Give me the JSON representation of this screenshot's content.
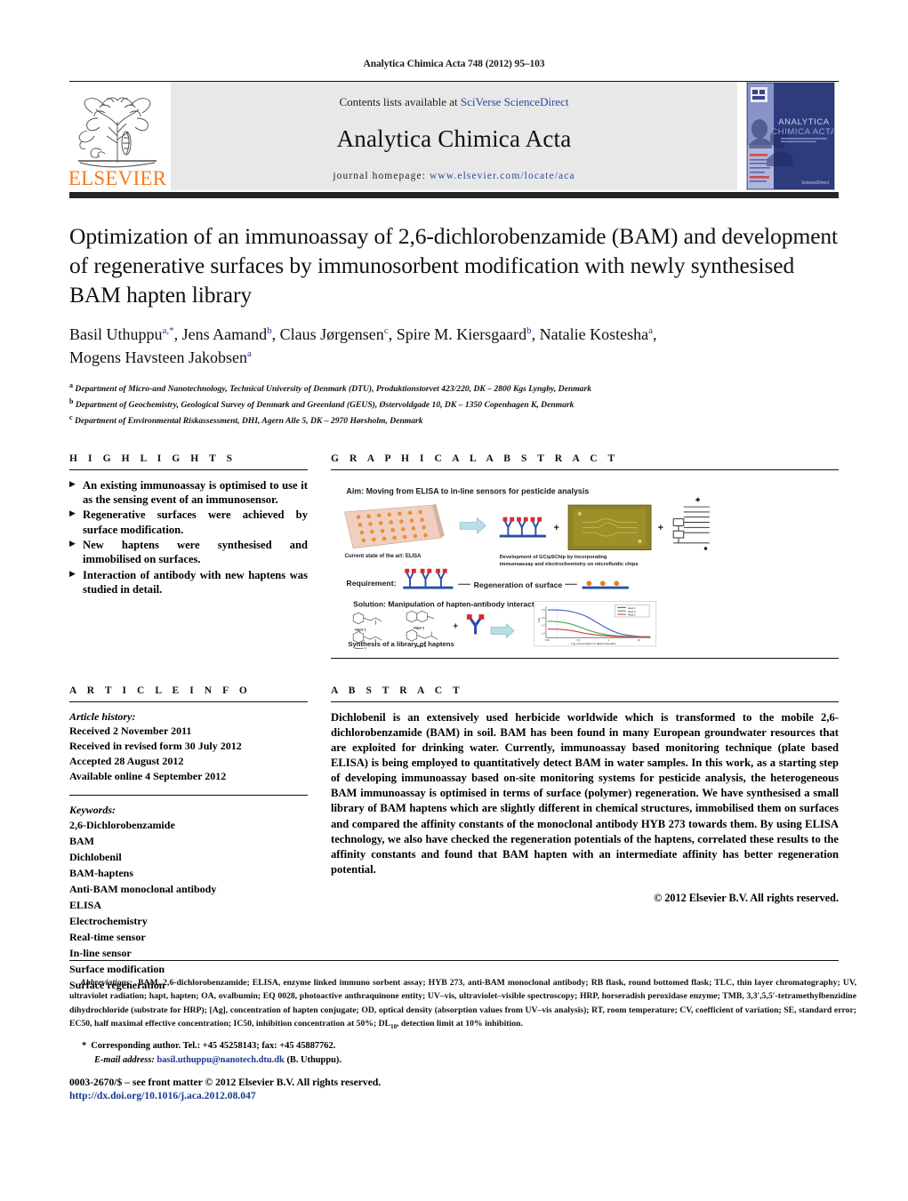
{
  "running_head": "Analytica Chimica Acta 748 (2012) 95–103",
  "masthead": {
    "publisher_logo_text": "ELSEVIER",
    "contents_prefix": "Contents lists available at ",
    "contents_link": "SciVerse ScienceDirect",
    "journal_title": "Analytica Chimica Acta",
    "homepage_label": "journal homepage: ",
    "homepage_url": "www.elsevier.com/locate/aca",
    "cover_title_line1": "ANALYTICA",
    "cover_title_line2": "CHIMICA ACTA"
  },
  "article": {
    "title": "Optimization of an immunoassay of 2,6-dichlorobenzamide (BAM) and development of regenerative surfaces by immunosorbent modification with newly synthesised BAM hapten library",
    "authors_line1": "Basil Uthuppu a,*, Jens Aamand b, Claus Jørgensen c, Spire M. Kiersgaard b, Natalie Kostesha a,",
    "authors_line2": "Mogens Havsteen Jakobsen a",
    "authors": [
      {
        "name": "Basil Uthuppu",
        "sup": "a,*"
      },
      {
        "name": "Jens Aamand",
        "sup": "b"
      },
      {
        "name": "Claus Jørgensen",
        "sup": "c"
      },
      {
        "name": "Spire M. Kiersgaard",
        "sup": "b"
      },
      {
        "name": "Natalie Kostesha",
        "sup": "a"
      },
      {
        "name": "Mogens Havsteen Jakobsen",
        "sup": "a"
      }
    ],
    "affiliations": [
      {
        "marker": "a",
        "text": "Department of Micro-and Nanotechnology, Technical University of Denmark (DTU), Produktionstorvet 423/220, DK – 2800 Kgs Lyngby, Denmark"
      },
      {
        "marker": "b",
        "text": "Department of Geochemistry, Geological Survey of Denmark and Greenland (GEUS), Østervoldgade 10, DK – 1350 Copenhagen K, Denmark"
      },
      {
        "marker": "c",
        "text": "Department of Environmental Riskassessment, DHI, Agern Alle 5, DK – 2970 Hørsholm, Denmark"
      }
    ]
  },
  "highlights": {
    "heading": "H I G H L I G H T S",
    "items": [
      "An existing immunoassay is optimised to use it as the sensing event of an immunosensor.",
      "Regenerative surfaces were achieved by surface modification.",
      "New haptens were synthesised and immobilised on surfaces.",
      "Interaction of antibody with new haptens was studied in detail."
    ]
  },
  "graphical_abstract": {
    "heading": "G R A P H I C A L   A B S T R A C T",
    "aim_line": "Aim: Moving from ELISA to in-line sensors for pesticide analysis",
    "caption_plate": "Current state of the art: ELISA",
    "caption_chip_line1": "Development of GC/µSChip by incorporating",
    "caption_chip_line2": "immunoassay and electrochemistry on microfluidic chips",
    "requirement_label": "Requirement:",
    "regeneration_label": "Regeneration of surface",
    "solution_line": "Solution: Manipulation of hapten-antibody interaction",
    "synthesis_caption": "Synthesis of a library of haptens",
    "structure_labels": [
      "Hapt 1",
      "Hapt 2",
      "Hapt 3",
      "Hapt 4"
    ],
    "chart_legend": [
      "Hapt 1",
      "Hapt 2",
      "Hapt 3"
    ],
    "chart_xlabel": "Log concentration of added standard",
    "chart_ylabel": "OD"
  },
  "article_info": {
    "heading": "A R T I C L E   I N F O",
    "history_label": "Article history:",
    "history": [
      "Received 2 November 2011",
      "Received in revised form 30 July 2012",
      "Accepted 28 August 2012",
      "Available online 4 September 2012"
    ],
    "keywords_label": "Keywords:",
    "keywords": [
      "2,6-Dichlorobenzamide",
      "BAM",
      "Dichlobenil",
      "BAM-haptens",
      "Anti-BAM monoclonal antibody",
      "ELISA",
      "Electrochemistry",
      "Real-time sensor",
      "In-line sensor",
      "Surface modification",
      "Surface regeneration"
    ]
  },
  "abstract": {
    "heading": "A B S T R A C T",
    "body": "Dichlobenil is an extensively used herbicide worldwide which is transformed to the mobile 2,6-dichlorobenzamide (BAM) in soil. BAM has been found in many European groundwater resources that are exploited for drinking water. Currently, immunoassay based monitoring technique (plate based ELISA) is being employed to quantitatively detect BAM in water samples. In this work, as a starting step of developing immunoassay based on-site monitoring systems for pesticide analysis, the heterogeneous BAM immunoassay is optimised in terms of surface (polymer) regeneration. We have synthesised a small library of BAM haptens which are slightly different in chemical structures, immobilised them on surfaces and compared the affinity constants of the monoclonal antibody HYB 273 towards them. By using ELISA technology, we also have checked the regeneration potentials of the haptens, correlated these results to the affinity constants and found that BAM hapten with an intermediate affinity has better regeneration potential.",
    "copyright": "© 2012 Elsevier B.V. All rights reserved."
  },
  "footer": {
    "abbrev_label": "Abbreviations:",
    "abbrev_text": "BAM, 2,6-dichlorobenzamide; ELISA, enzyme linked immuno sorbent assay; HYB 273, anti-BAM monoclonal antibody; RB flask, round bottomed flask; TLC, thin layer chromatography; UV, ultraviolet radiation; hapt, hapten; OA, ovalbumin; EQ 0028, photoactive anthraquinone entity; UV–vis, ultraviolet–visible spectroscopy; HRP, horseradish peroxidase enzyme; TMB, 3,3′,5,5′-tetramethylbenzidine dihydrochloride (substrate for HRP); [Ag], concentration of hapten conjugate; OD, optical density (absorption values from UV–vis analysis); RT, room temperature; CV, coefficient of variation; SE, standard error; EC50, half maximal effective concentration; IC50, inhibition concentration at 50%; DL",
    "abbrev_sub": "10",
    "abbrev_tail": ", detection limit at 10% inhibition.",
    "corresponding": "Corresponding author. Tel.: +45 45258143; fax: +45 45887762.",
    "email_label": "E-mail address:",
    "email": "basil.uthuppu@nanotech.dtu.dk",
    "email_owner": "(B. Uthuppu).",
    "issn_line": "0003-2670/$ – see front matter © 2012 Elsevier B.V. All rights reserved.",
    "doi": "http://dx.doi.org/10.1016/j.aca.2012.08.047"
  },
  "colors": {
    "elsevier_orange": "#F47B20",
    "link_blue": "#1a3a8f",
    "band_gray": "#e8e8e8",
    "rule_black": "#262626"
  }
}
